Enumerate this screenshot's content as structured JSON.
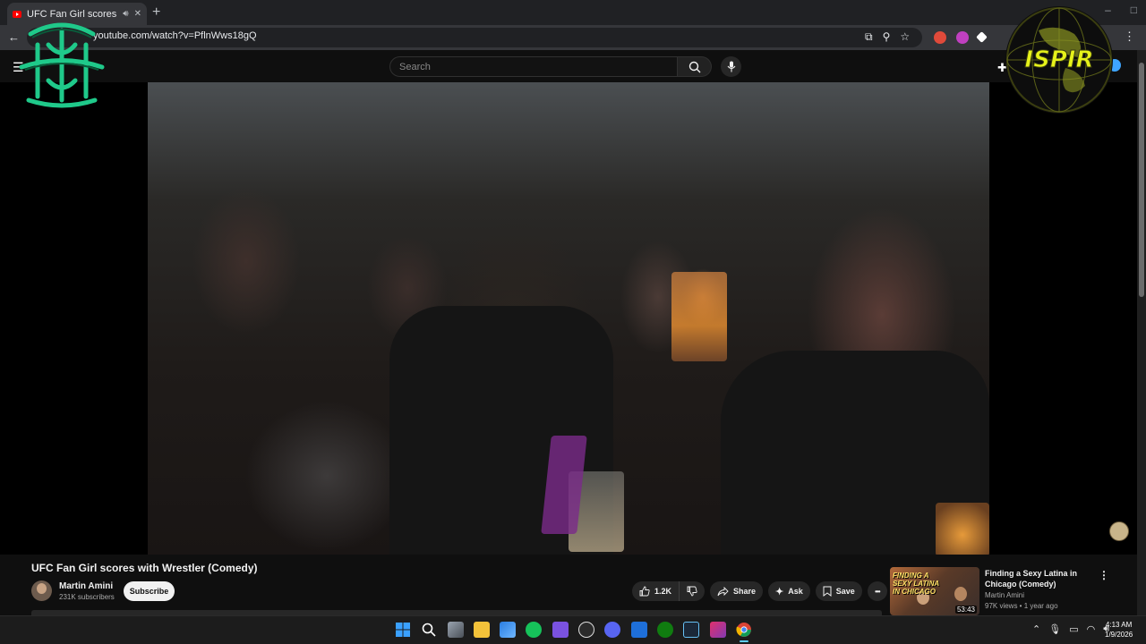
{
  "browser": {
    "tab_title": "UFC Fan Girl scores with W",
    "tab_audio_icon": "speaker-icon",
    "tab_close": "✕",
    "new_tab": "+",
    "url": "youtube.com/watch?v=PflnWws18gQ"
  },
  "youtube": {
    "search_placeholder": "Search"
  },
  "video": {
    "title": "UFC Fan Girl scores with Wrestler (Comedy)",
    "channel_name": "Martin Amini",
    "channel_subs": "231K subscribers",
    "subscribe_label": "Subscribe",
    "like_count": "1.2K",
    "share_label": "Share",
    "ask_label": "Ask",
    "save_label": "Save",
    "more_label": "•••"
  },
  "recommendation": {
    "thumb_text": "FINDING A SEXY LATINA IN CHICAGO",
    "duration": "53:43",
    "title": "Finding a Sexy Latina in Chicago (Comedy)",
    "channel": "Martin Amini",
    "meta": "97K views • 1 year ago"
  },
  "overlay": {
    "right_logo_text": "ISPIR"
  },
  "taskbar": {
    "time": "4:13 AM",
    "date": "1/9/2026"
  },
  "colors": {
    "background": "#0f0f0f",
    "pill": "#272727",
    "accent_red": "#ff0000",
    "logo_green": "#1fc98a",
    "logo_yellow": "#e6f21a"
  }
}
